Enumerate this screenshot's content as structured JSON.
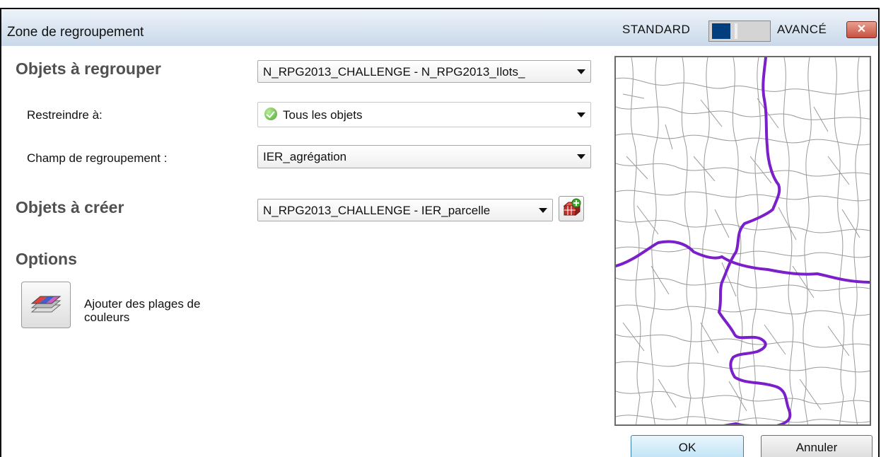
{
  "window": {
    "title": "Zone de regroupement",
    "mode_standard": "STANDARD",
    "mode_advanced": "AVANCÉ",
    "close_symbol": "✕"
  },
  "sections": {
    "objects_to_group": "Objets à regrouper",
    "objects_to_create": "Objets à créer",
    "options": "Options"
  },
  "fields": {
    "source_layer_value": "N_RPG2013_CHALLENGE - N_RPG2013_Ilots_",
    "restrict_label": "Restreindre à:",
    "restrict_value": "Tous les objets",
    "group_field_label": "Champ de regroupement :",
    "group_field_value": "IER_agrégation",
    "target_layer_value": "N_RPG2013_CHALLENGE - IER_parcelle"
  },
  "options": {
    "color_ranges_label": "Ajouter des plages de couleurs"
  },
  "buttons": {
    "ok": "OK",
    "cancel": "Annuler"
  },
  "icons": {
    "restrict": "check-circle-icon",
    "add_layer": "add-layer-icon",
    "color_ranges": "color-ranges-icon"
  },
  "colors": {
    "boundary": "#7a1fc9",
    "toggle_knob": "#003e7e",
    "close": "#c75040"
  }
}
